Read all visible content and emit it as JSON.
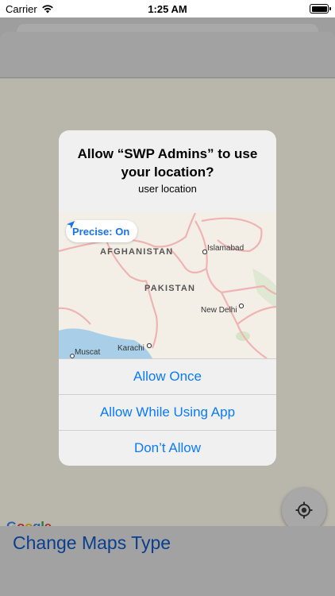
{
  "status_bar": {
    "carrier": "Carrier",
    "time": "1:25 AM"
  },
  "map": {
    "logo_letters": [
      {
        "ch": "G",
        "color": "#4285F4"
      },
      {
        "ch": "o",
        "color": "#EA4335"
      },
      {
        "ch": "o",
        "color": "#FBBC05"
      },
      {
        "ch": "g",
        "color": "#4285F4"
      },
      {
        "ch": "l",
        "color": "#34A853"
      },
      {
        "ch": "e",
        "color": "#EA4335"
      }
    ],
    "locate_icon": "crosshair-icon"
  },
  "bottom": {
    "change_maps_type": "Change Maps Type"
  },
  "alert": {
    "title": "Allow “SWP Admins” to use your location?",
    "message": "user location",
    "precise_label": "Precise: On",
    "map_labels": {
      "afghanistan": "AFGHANISTAN",
      "pakistan": "PAKISTAN",
      "islamabad": "Islamabad",
      "new_delhi": "New Delhi",
      "karachi": "Karachi",
      "muscat": "Muscat"
    },
    "buttons": {
      "allow_once": "Allow Once",
      "allow_while_using": "Allow While Using App",
      "dont_allow": "Don’t Allow"
    }
  },
  "colors": {
    "accent": "#0a7aff",
    "link_dim": "#0a3f8f"
  }
}
